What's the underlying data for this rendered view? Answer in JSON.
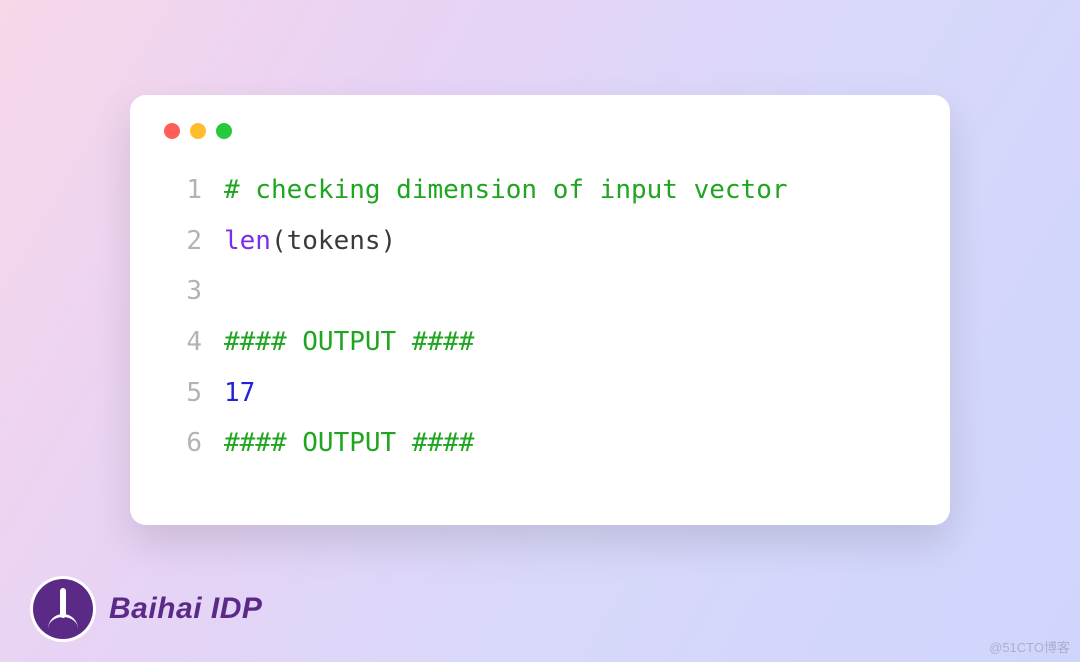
{
  "code": {
    "lines": [
      {
        "n": "1",
        "tokens": [
          {
            "cls": "tk-comment",
            "t": "# checking dimension of input vector"
          }
        ]
      },
      {
        "n": "2",
        "tokens": [
          {
            "cls": "tk-func",
            "t": "len"
          },
          {
            "cls": "tk-plain",
            "t": "(tokens)"
          }
        ]
      },
      {
        "n": "3",
        "tokens": [
          {
            "cls": "tk-plain",
            "t": ""
          }
        ]
      },
      {
        "n": "4",
        "tokens": [
          {
            "cls": "tk-comment",
            "t": "#### OUTPUT ####"
          }
        ]
      },
      {
        "n": "5",
        "tokens": [
          {
            "cls": "tk-number",
            "t": "17"
          }
        ]
      },
      {
        "n": "6",
        "tokens": [
          {
            "cls": "tk-comment",
            "t": "#### OUTPUT ####"
          }
        ]
      }
    ]
  },
  "brand": {
    "name": "Baihai IDP"
  },
  "watermark": "@51CTO博客"
}
